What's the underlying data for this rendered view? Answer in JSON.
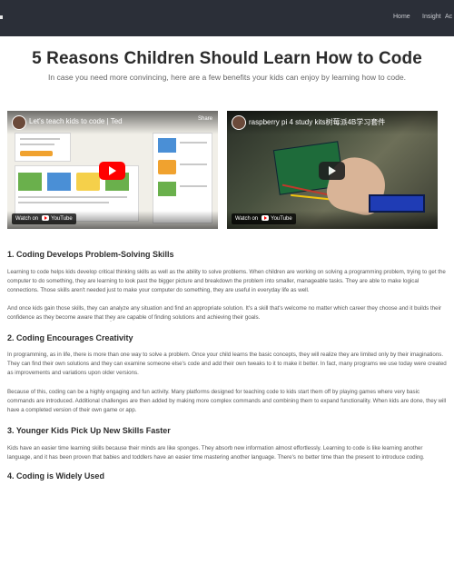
{
  "header": {
    "nav": [
      "Home",
      "Insight",
      "Ac"
    ]
  },
  "page": {
    "title": "5 Reasons Children Should Learn How to Code",
    "subtitle": "In case you need more convincing, here are a few benefits your kids can enjoy by learning how to code."
  },
  "videos": [
    {
      "title": "Let's teach kids to code | Ted",
      "share": "Share",
      "watch_on": "Watch on",
      "platform": "YouTube",
      "play_color": "#ff0000"
    },
    {
      "title": "raspberry pi 4 study kits树莓派4B学习套件",
      "watch_on": "Watch on",
      "platform": "YouTube"
    }
  ],
  "sections": [
    {
      "heading": "1. Coding Develops Problem-Solving Skills",
      "paragraphs": [
        "Learning to code helps kids develop critical thinking skills as well as the ability to solve problems. When children are working on solving a programming problem, trying to get the computer to do something, they are learning to look past the bigger picture and breakdown the problem into smaller, manageable tasks. They are able to make logical connections. Those skills aren't needed just to make your computer do something, they are useful in everyday life as well.",
        "And once kids gain those skills, they can analyze any situation and find an appropriate solution. It's a skill that's welcome no matter which career they choose and it builds their confidence as they become aware that they are capable of finding solutions and achieving their goals."
      ]
    },
    {
      "heading": "2. Coding Encourages Creativity",
      "paragraphs": [
        "In programming, as in life, there is more than one way to solve a problem. Once your child learns the basic concepts, they will realize they are limited only by their imaginations. They can find their own solutions and they can examine someone else's code and add their own tweaks to it to make it better. In fact, many programs we use today were created as improvements and variations upon older versions.",
        "Because of this, coding can be a highly engaging and fun activity. Many platforms designed for teaching code to kids start them off by playing games where very basic commands are introduced. Additional challenges are then added by making more complex commands and combining them to expand functionality. When kids are done, they will have a completed version of their own game or app."
      ]
    },
    {
      "heading": "3. Younger Kids Pick Up New Skills Faster",
      "paragraphs": [
        "Kids have an easier time learning skills because their minds are like sponges. They absorb new information almost effortlessly. Learning to code is like learning another language, and it has been proven that babies and toddlers have an easier time mastering another language. There's no better time than the present to introduce coding."
      ]
    },
    {
      "heading": "4. Coding is Widely Used",
      "paragraphs": []
    }
  ]
}
